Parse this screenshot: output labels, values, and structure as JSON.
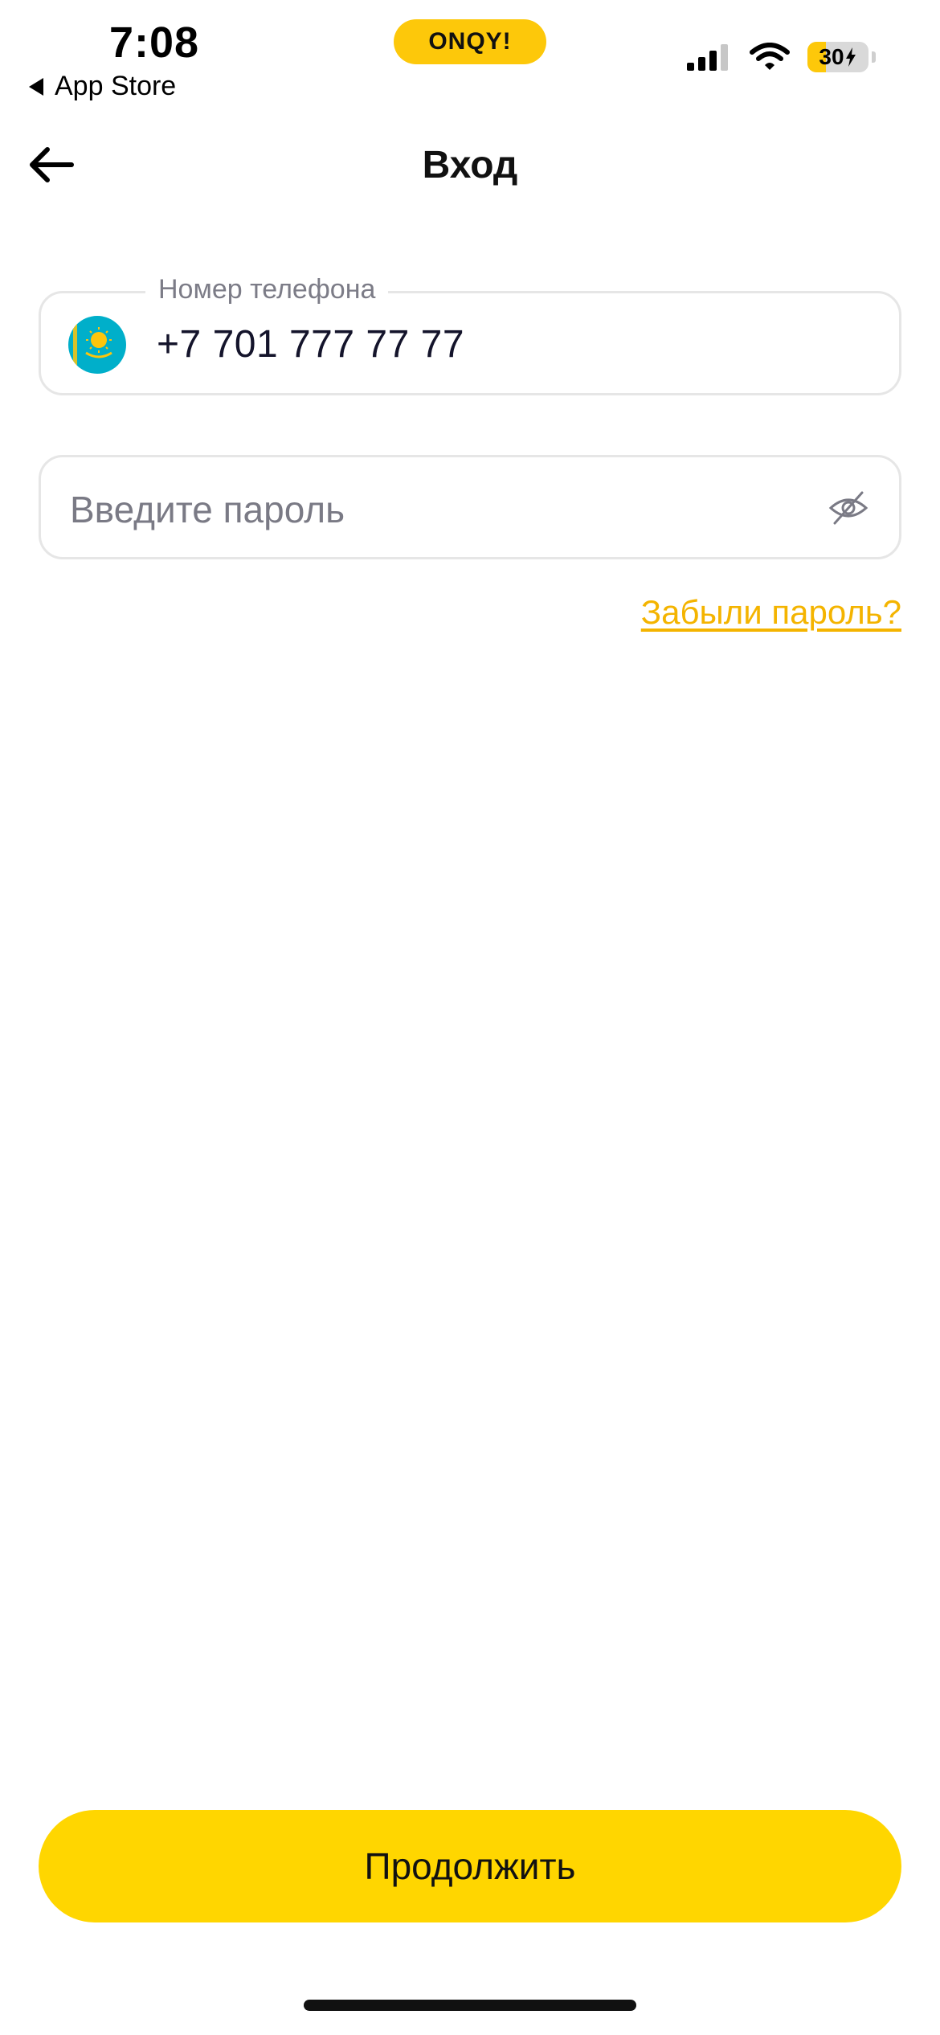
{
  "status_bar": {
    "time": "7:08",
    "back_app": "App Store",
    "island_label": "ONQY!",
    "battery": "30",
    "icons": [
      "signal-icon",
      "wifi-icon",
      "battery-icon",
      "bolt-icon"
    ]
  },
  "nav": {
    "title": "Вход",
    "back_icon": "arrow-left-icon"
  },
  "phone_field": {
    "label": "Номер телефона",
    "value": "+7 701 777 77 77",
    "flag_icon": "kazakhstan-flag-icon"
  },
  "password_field": {
    "placeholder": "Введите пароль",
    "toggle_icon": "eye-off-icon"
  },
  "forgot_link": "Забыли пароль?",
  "continue_button": "Продолжить",
  "colors": {
    "accent": "#FFD600",
    "link": "#F4B400",
    "border": "#e6e6e6",
    "flag_blue": "#00AFCA",
    "flag_gold": "#FEC50C"
  }
}
